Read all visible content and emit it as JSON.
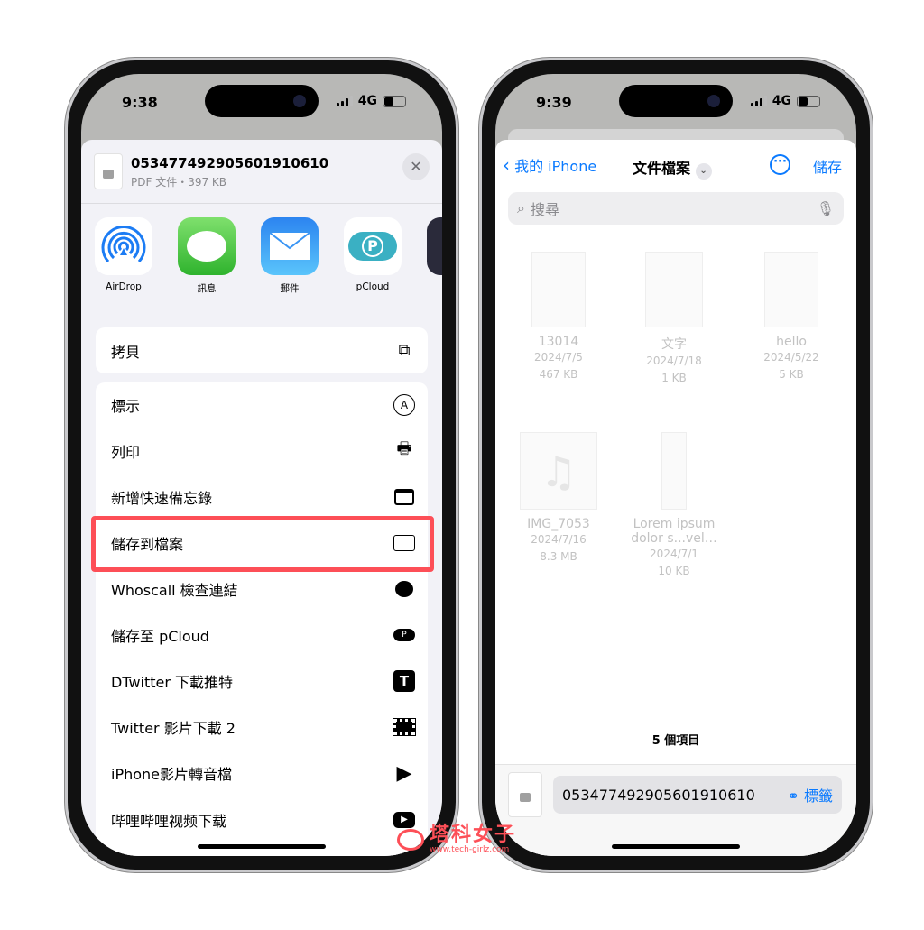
{
  "left": {
    "status": {
      "time": "9:38",
      "network": "4G"
    },
    "file": {
      "name": "053477492905601910610",
      "meta": "PDF 文件・397 KB"
    },
    "apps": [
      {
        "label": "AirDrop",
        "icon": "airdrop-icon"
      },
      {
        "label": "訊息",
        "icon": "messages-icon"
      },
      {
        "label": "郵件",
        "icon": "mail-icon"
      },
      {
        "label": "pCloud",
        "icon": "pcloud-icon"
      }
    ],
    "copy": {
      "label": "拷貝",
      "icon": "copy-icon"
    },
    "actions": [
      {
        "label": "標示",
        "icon": "markup-icon"
      },
      {
        "label": "列印",
        "icon": "printer-icon"
      },
      {
        "label": "新增快速備忘錄",
        "icon": "quick-note-icon"
      },
      {
        "label": "儲存到檔案",
        "icon": "folder-icon",
        "highlighted": true
      },
      {
        "label": "Whoscall 檢查連結",
        "icon": "whoscall-icon"
      },
      {
        "label": "儲存至 pCloud",
        "icon": "pcloud-icon"
      },
      {
        "label": "DTwitter 下載推特",
        "icon": "t-icon"
      },
      {
        "label": "Twitter 影片下載 2",
        "icon": "film-icon"
      },
      {
        "label": "iPhone影片轉音檔",
        "icon": "play-icon"
      },
      {
        "label": "哔哩哔哩视频下载",
        "icon": "youtube-play-icon"
      }
    ],
    "highlight_color": "#fd4f57"
  },
  "right": {
    "status": {
      "time": "9:39",
      "network": "4G"
    },
    "nav": {
      "back": "我的 iPhone",
      "title": "文件檔案",
      "save": "儲存"
    },
    "search": {
      "placeholder": "搜尋"
    },
    "files": [
      {
        "name": "13014",
        "date": "2024/7/5",
        "size": "467 KB"
      },
      {
        "name": "文字",
        "date": "2024/7/18",
        "size": "1 KB"
      },
      {
        "name": "hello",
        "date": "2024/5/22",
        "size": "5 KB"
      },
      {
        "name": "IMG_7053",
        "date": "2024/7/16",
        "size": "8.3 MB"
      },
      {
        "name": "Lorem ipsum dolor s...vel…",
        "date": "2024/7/1",
        "size": "10 KB"
      }
    ],
    "count": "5 個項目",
    "filename": "053477492905601910610",
    "tags": "標籤",
    "accent": "#0a7aff"
  },
  "watermark": {
    "name": "塔科女子",
    "url": "www.tech-girlz.com"
  }
}
